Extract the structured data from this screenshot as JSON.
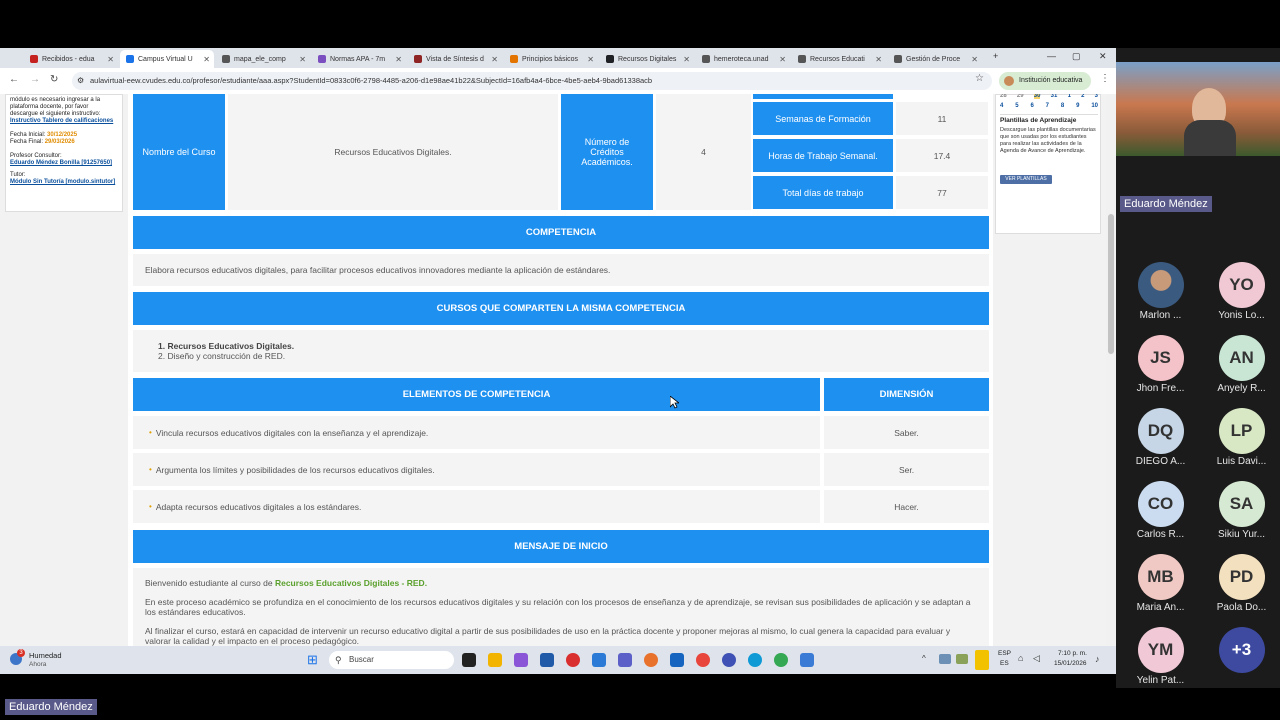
{
  "browser": {
    "tabs": [
      {
        "label": "Recibidos - edua",
        "color": "#c5221f"
      },
      {
        "label": "Campus Virtual U",
        "color": "#1a73e8"
      },
      {
        "label": "mapa_ele_comp",
        "color": "#555555"
      },
      {
        "label": "Normas APA - 7m",
        "color": "#7b4fbf"
      },
      {
        "label": "Vista de Síntesis d",
        "color": "#8e2424"
      },
      {
        "label": "Principios básicos",
        "color": "#e37400"
      },
      {
        "label": "Recursos Digitales",
        "color": "#202124"
      },
      {
        "label": "hemeroteca.unad",
        "color": "#555555"
      },
      {
        "label": "Recursos Educati",
        "color": "#555555"
      },
      {
        "label": "Gestión de Proce",
        "color": "#555555"
      }
    ],
    "url": "aulavirtual-eew.cvudes.edu.co/profesor/estudiante/aaa.aspx?StudentId=0833c0f6-2798-4485-a206-d1e98ae41b22&SubjectId=16afb4a4-6bce-4be5-aeb4-9bad61338acb",
    "profile_label": "Institución educativa"
  },
  "sidebar": {
    "intro_text": "módulo es necesario ingresar a la plataforma docente, por favor descargue el siguiente instructivo:",
    "instructivo_link": "Instructivo Tablero de calificaciones",
    "fecha_inicial_label": "Fecha Inicial:",
    "fecha_inicial": "30/12/2025",
    "fecha_final_label": "Fecha Final:",
    "fecha_final": "29/03/2026",
    "consultor_label": "Profesor Consultor:",
    "consultor_name": "Eduardo Méndez Bonilla [91257650]",
    "tutor_label": "Tutor:",
    "tutor_name": "Módulo Sin Tutoría [modulo.sintutor]"
  },
  "course": {
    "name_label": "Nombre del Curso",
    "name_value": "Recursos Educativos Digitales.",
    "credits_label": "Número de Créditos Académicos.",
    "credits_value": "4",
    "weeks_label": "Semanas de Formación",
    "weeks_value": "11",
    "hours_label": "Horas de Trabajo Semanal.",
    "hours_value": "17.4",
    "days_label": "Total días de trabajo",
    "days_value": "77"
  },
  "competencia": {
    "header": "COMPETENCIA",
    "text": "Elabora recursos educativos digitales, para facilitar procesos educativos innovadores mediante la aplicación de estándares."
  },
  "cursos": {
    "header": "CURSOS QUE COMPARTEN LA MISMA COMPETENCIA",
    "items": [
      "1. Recursos Educativos Digitales.",
      "2. Diseño y construcción de RED."
    ]
  },
  "elementos": {
    "header": "ELEMENTOS DE COMPETENCIA",
    "dim_header": "DIMENSIÓN",
    "rows": [
      {
        "text": "Vincula recursos educativos digitales con la enseñanza y el aprendizaje.",
        "dim": "Saber."
      },
      {
        "text": "Argumenta los límites y posibilidades de los recursos educativos digitales.",
        "dim": "Ser."
      },
      {
        "text": "Adapta recursos educativos digitales a los estándares.",
        "dim": "Hacer."
      }
    ]
  },
  "mensaje": {
    "header": "MENSAJE DE INICIO",
    "welcome_prefix": "Bienvenido estudiante al curso de ",
    "welcome_course": "Recursos Educativos Digitales - RED.",
    "p1": "En este proceso académico se profundiza en el conocimiento de los recursos educativos digitales y su relación con los procesos de enseñanza y de aprendizaje, se revisan sus posibilidades de aplicación y se adaptan a los estándares educativos.",
    "p2": "Al finalizar el curso, estará en capacidad de intervenir un recurso educativo digital a partir de sus posibilidades de uso en la práctica docente y proponer mejoras al mismo, lo cual genera la capacidad para evaluar y valorar la calidad y el impacto en el proceso pedagógico."
  },
  "rightpanel": {
    "cal_row1": [
      "28",
      "29",
      "30",
      "31",
      "1",
      "2",
      "3"
    ],
    "cal_row2": [
      "4",
      "5",
      "6",
      "7",
      "8",
      "9",
      "10"
    ],
    "title": "Plantillas de Aprendizaje",
    "text": "Descargue las plantillas documentarias que son usadas por los estudiantes para realizar las actividades de la Agenda de Avance de Aprendizaje.",
    "button": "VER PLANTILLAS"
  },
  "taskbar": {
    "weather_title": "Humedad",
    "weather_sub": "Ahora",
    "weather_badge": "3",
    "search_placeholder": "Buscar",
    "lang1": "ESP",
    "lang2": "ES",
    "time": "7:10 p. m.",
    "date": "15/01/2026"
  },
  "meeting": {
    "presenter": "Eduardo Méndez",
    "participants": [
      {
        "initials": "",
        "name": "Marlon ...",
        "color": "#3a5a80"
      },
      {
        "initials": "YO",
        "name": "Yonis Lo...",
        "color": "#f0c9d4"
      },
      {
        "initials": "JS",
        "name": "Jhon Fre...",
        "color": "#f3c3c9"
      },
      {
        "initials": "AN",
        "name": "Anyely R...",
        "color": "#c9e6d5"
      },
      {
        "initials": "DQ",
        "name": "DIEGO A...",
        "color": "#c6d6e6"
      },
      {
        "initials": "LP",
        "name": "Luis Davi...",
        "color": "#d8e7c4"
      },
      {
        "initials": "CO",
        "name": "Carlos R...",
        "color": "#cbdcf0"
      },
      {
        "initials": "SA",
        "name": "Sikiu Yur...",
        "color": "#d6e9d2"
      },
      {
        "initials": "MB",
        "name": "Maria An...",
        "color": "#f1c9c4"
      },
      {
        "initials": "PD",
        "name": "Paola Do...",
        "color": "#f3e0bf"
      },
      {
        "initials": "YM",
        "name": "Yelin Pat...",
        "color": "#f1c9d6"
      },
      {
        "initials": "+3",
        "name": "",
        "color": "#3d4aa0"
      }
    ],
    "bottom_badge": "Eduardo Méndez"
  }
}
